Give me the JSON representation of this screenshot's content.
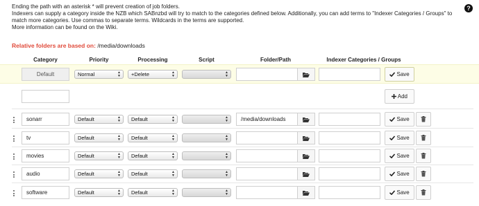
{
  "intro": {
    "line1": "Ending the path with an asterisk * will prevent creation of job folders.",
    "line2": "Indexers can supply a category inside the NZB which SABnzbd will try to match to the categories defined below. Additionally, you can add terms to \"Indexer Categories / Groups\" to",
    "line3": "match more categories. Use commas to separate terms. Wildcards in the terms are supported.",
    "line4": "More information can be found on the Wiki."
  },
  "help_icon": "?",
  "relative": {
    "label": "Relative folders are based on:",
    "path": "/media/downloads"
  },
  "headers": {
    "category": "Category",
    "priority": "Priority",
    "processing": "Processing",
    "script": "Script",
    "folder": "Folder/Path",
    "indexer": "Indexer Categories / Groups"
  },
  "default_row": {
    "category": "Default",
    "priority": "Normal",
    "processing": "+Delete",
    "script": "",
    "folder": "",
    "indexer": "",
    "save_label": "Save"
  },
  "add_row": {
    "category": "",
    "add_label": "Add"
  },
  "categories": [
    {
      "name": "sonarr",
      "priority": "Default",
      "processing": "Default",
      "script": "",
      "folder": "/media/downloads",
      "indexer": "",
      "save_label": "Save"
    },
    {
      "name": "tv",
      "priority": "Default",
      "processing": "Default",
      "script": "",
      "folder": "",
      "indexer": "",
      "save_label": "Save"
    },
    {
      "name": "movies",
      "priority": "Default",
      "processing": "Default",
      "script": "",
      "folder": "",
      "indexer": "",
      "save_label": "Save"
    },
    {
      "name": "audio",
      "priority": "Default",
      "processing": "Default",
      "script": "",
      "folder": "",
      "indexer": "",
      "save_label": "Save"
    },
    {
      "name": "software",
      "priority": "Default",
      "processing": "Default",
      "script": "",
      "folder": "",
      "indexer": "",
      "save_label": "Save"
    }
  ],
  "icons": {
    "help": "question-circle-icon",
    "folder": "folder-open-icon",
    "save": "check-icon",
    "add": "plus-icon",
    "delete": "trash-icon",
    "drag": "drag-handle-icon",
    "select": "select-arrows-icon"
  },
  "colors": {
    "accent_red": "#e04a3a",
    "highlight_row": "#fdfde6"
  }
}
